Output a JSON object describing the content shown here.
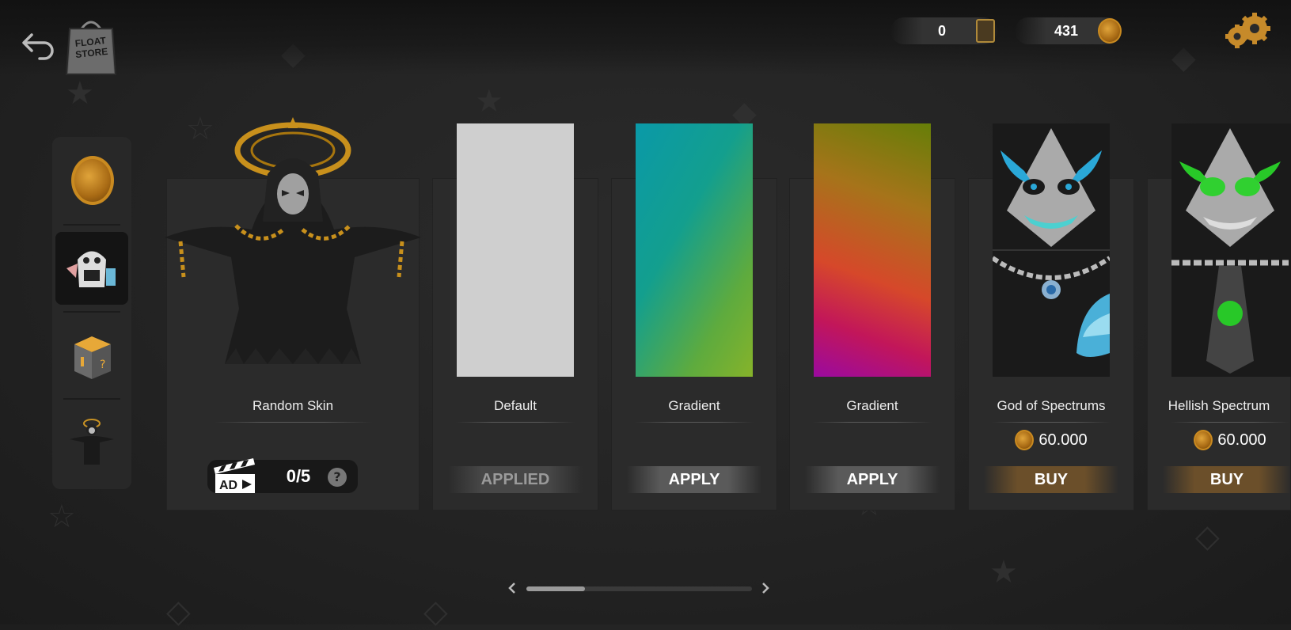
{
  "header": {
    "store_label_line1": "FLOAT",
    "store_label_line2": "STORE",
    "pass_count": "0",
    "coin_count": "431"
  },
  "cards": [
    {
      "name": "Random Skin",
      "ad_progress": "0/5",
      "help": "?",
      "ad_label": "AD"
    },
    {
      "name": "Default",
      "button": "APPLIED"
    },
    {
      "name": "Gradient",
      "button": "APPLY"
    },
    {
      "name": "Gradient",
      "button": "APPLY"
    },
    {
      "name": "God of Spectrums",
      "price": "60.000",
      "button": "BUY"
    },
    {
      "name": "Hellish Spectrum",
      "price": "60.000",
      "button": "BUY"
    }
  ],
  "colors": {
    "default_swatch": "#cfcfcf",
    "gradient_1": [
      "#0aa1a0",
      "#7fb22e"
    ],
    "gradient_2": [
      "#9c0b9f",
      "#e01b27",
      "#c8b44a",
      "#6e8a0e"
    ],
    "buy_button": "#6b4f2a",
    "coin": "#c98a20"
  },
  "scroll": {
    "position": 0.18
  }
}
